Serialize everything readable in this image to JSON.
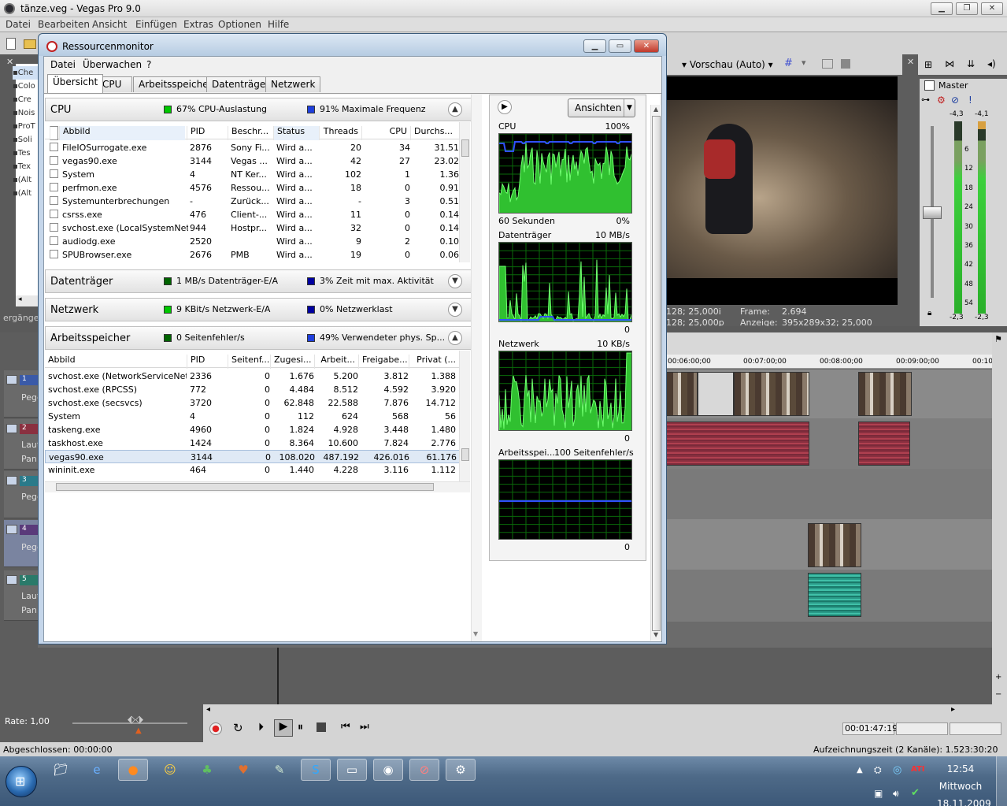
{
  "vegas": {
    "title": "tänze.veg - Vegas Pro 9.0",
    "menu": [
      "Datei",
      "Bearbeiten",
      "Ansicht",
      "Einfügen",
      "Extras",
      "Optionen",
      "Hilfe"
    ],
    "preview_label": "Vorschau (Auto)",
    "master_label": "Master",
    "meter_top": [
      "-4,3",
      "-4,1"
    ],
    "meter_scale": [
      "6",
      "12",
      "18",
      "24",
      "30",
      "36",
      "42",
      "48",
      "54"
    ],
    "meter_bottom": [
      "-2,3",
      "-2,3"
    ],
    "preview_info": {
      "line1_left": "128; 25,000i",
      "line2_left": "128; 25,000p",
      "frame_label": "Frame:",
      "frame_value": "2.694",
      "display_label": "Anzeige:",
      "display_value": "395x289x32; 25,000"
    },
    "explorer_items": [
      "Che",
      "Colo",
      "Cre",
      "Nois",
      "ProT",
      "Soli",
      "Tes",
      "Tex",
      "(Alt",
      "(Alt"
    ],
    "explorer_tab": "ergänge",
    "timeline_marks": [
      "00:06:00;00",
      "00:07:00;00",
      "00:08:00;00",
      "00:09:00;00",
      "00:10"
    ],
    "tracks": [
      {
        "num": "1",
        "label": "Pege",
        "color": "#3a5aa8"
      },
      {
        "num": "2",
        "label": "Laut",
        "label2": "Pan:",
        "color": "#8a3040"
      },
      {
        "num": "3",
        "label": "Pege",
        "color": "#2a7a8a"
      },
      {
        "num": "4",
        "label": "Pege",
        "color": "#5a3a7a"
      },
      {
        "num": "5",
        "label": "Laut",
        "label2": "Pan:",
        "color": "#2a7a6a"
      }
    ],
    "rate_label": "Rate: 1,00",
    "timecode": "00:01:47:19",
    "status_left": "Abgeschlossen: 00:00:00",
    "status_right": "Aufzeichnungszeit (2 Kanäle): 1.523:30:20"
  },
  "taskbar": {
    "time": "12:54",
    "day": "Mittwoch",
    "date": "18.11.2009",
    "ati": "ATI"
  },
  "rm": {
    "title": "Ressourcenmonitor",
    "menu": [
      "Datei",
      "Überwachen",
      "?"
    ],
    "tabs": [
      "Übersicht",
      "CPU",
      "Arbeitsspeicher",
      "Datenträger",
      "Netzwerk"
    ],
    "cpu": {
      "name": "CPU",
      "stat1": "67% CPU-Auslastung",
      "stat2": "91% Maximale Frequenz",
      "columns": [
        "Abbild",
        "PID",
        "Beschr...",
        "Status",
        "Threads",
        "CPU",
        "Durchs..."
      ],
      "rows": [
        [
          "FileIOSurrogate.exe",
          "2876",
          "Sony Fi...",
          "Wird a...",
          "20",
          "34",
          "31.51"
        ],
        [
          "vegas90.exe",
          "3144",
          "Vegas ...",
          "Wird a...",
          "42",
          "27",
          "23.02"
        ],
        [
          "System",
          "4",
          "NT Ker...",
          "Wird a...",
          "102",
          "1",
          "1.36"
        ],
        [
          "perfmon.exe",
          "4576",
          "Ressou...",
          "Wird a...",
          "18",
          "0",
          "0.91"
        ],
        [
          "Systemunterbrechungen",
          "-",
          "Zurück...",
          "Wird a...",
          "-",
          "3",
          "0.51"
        ],
        [
          "csrss.exe",
          "476",
          "Client-...",
          "Wird a...",
          "11",
          "0",
          "0.14"
        ],
        [
          "svchost.exe (LocalSystemNet...",
          "944",
          "Hostpr...",
          "Wird a...",
          "32",
          "0",
          "0.14"
        ],
        [
          "audiodg.exe",
          "2520",
          "",
          "Wird a...",
          "9",
          "2",
          "0.10"
        ],
        [
          "SPUBrowser.exe",
          "2676",
          "PMB",
          "Wird a...",
          "19",
          "0",
          "0.06"
        ]
      ]
    },
    "disk": {
      "name": "Datenträger",
      "stat1": "1 MB/s Datenträger-E/A",
      "stat2": "3% Zeit mit max. Aktivität"
    },
    "net": {
      "name": "Netzwerk",
      "stat1": "9 KBit/s Netzwerk-E/A",
      "stat2": "0% Netzwerklast"
    },
    "mem": {
      "name": "Arbeitsspeicher",
      "stat1": "0 Seitenfehler/s",
      "stat2": "49% Verwendeter phys. Sp...",
      "columns": [
        "Abbild",
        "PID",
        "Seitenf...",
        "Zugesi...",
        "Arbeit...",
        "Freigabe...",
        "Privat (..."
      ],
      "rows": [
        [
          "svchost.exe (NetworkServiceNet...",
          "2336",
          "0",
          "1.676",
          "5.200",
          "3.812",
          "1.388"
        ],
        [
          "svchost.exe (RPCSS)",
          "772",
          "0",
          "4.484",
          "8.512",
          "4.592",
          "3.920"
        ],
        [
          "svchost.exe (secsvcs)",
          "3720",
          "0",
          "62.848",
          "22.588",
          "7.876",
          "14.712"
        ],
        [
          "System",
          "4",
          "0",
          "112",
          "624",
          "568",
          "56"
        ],
        [
          "taskeng.exe",
          "4960",
          "0",
          "1.824",
          "4.928",
          "3.448",
          "1.480"
        ],
        [
          "taskhost.exe",
          "1424",
          "0",
          "8.364",
          "10.600",
          "7.824",
          "2.776"
        ],
        [
          "vegas90.exe",
          "3144",
          "0",
          "108.020",
          "487.192",
          "426.016",
          "61.176"
        ],
        [
          "wininit.exe",
          "464",
          "0",
          "1.440",
          "4.228",
          "3.116",
          "1.112"
        ]
      ],
      "selected_row": 6
    },
    "right": {
      "ansichten": "Ansichten",
      "graphs": [
        {
          "title": "CPU",
          "max": "100%",
          "foot_left": "60 Sekunden",
          "foot_right": "0%"
        },
        {
          "title": "Datenträger",
          "max": "10 MB/s",
          "foot_left": "",
          "foot_right": "0"
        },
        {
          "title": "Netzwerk",
          "max": "10 KB/s",
          "foot_left": "",
          "foot_right": "0"
        },
        {
          "title": "Arbeitsspei...",
          "max": "100 Seitenfehler/s",
          "foot_left": "",
          "foot_right": "0"
        }
      ]
    },
    "colors": {
      "green": "#00c800",
      "blue": "#1f3fdc",
      "dark_green": "#006400",
      "dark_blue": "#0000a0"
    }
  }
}
